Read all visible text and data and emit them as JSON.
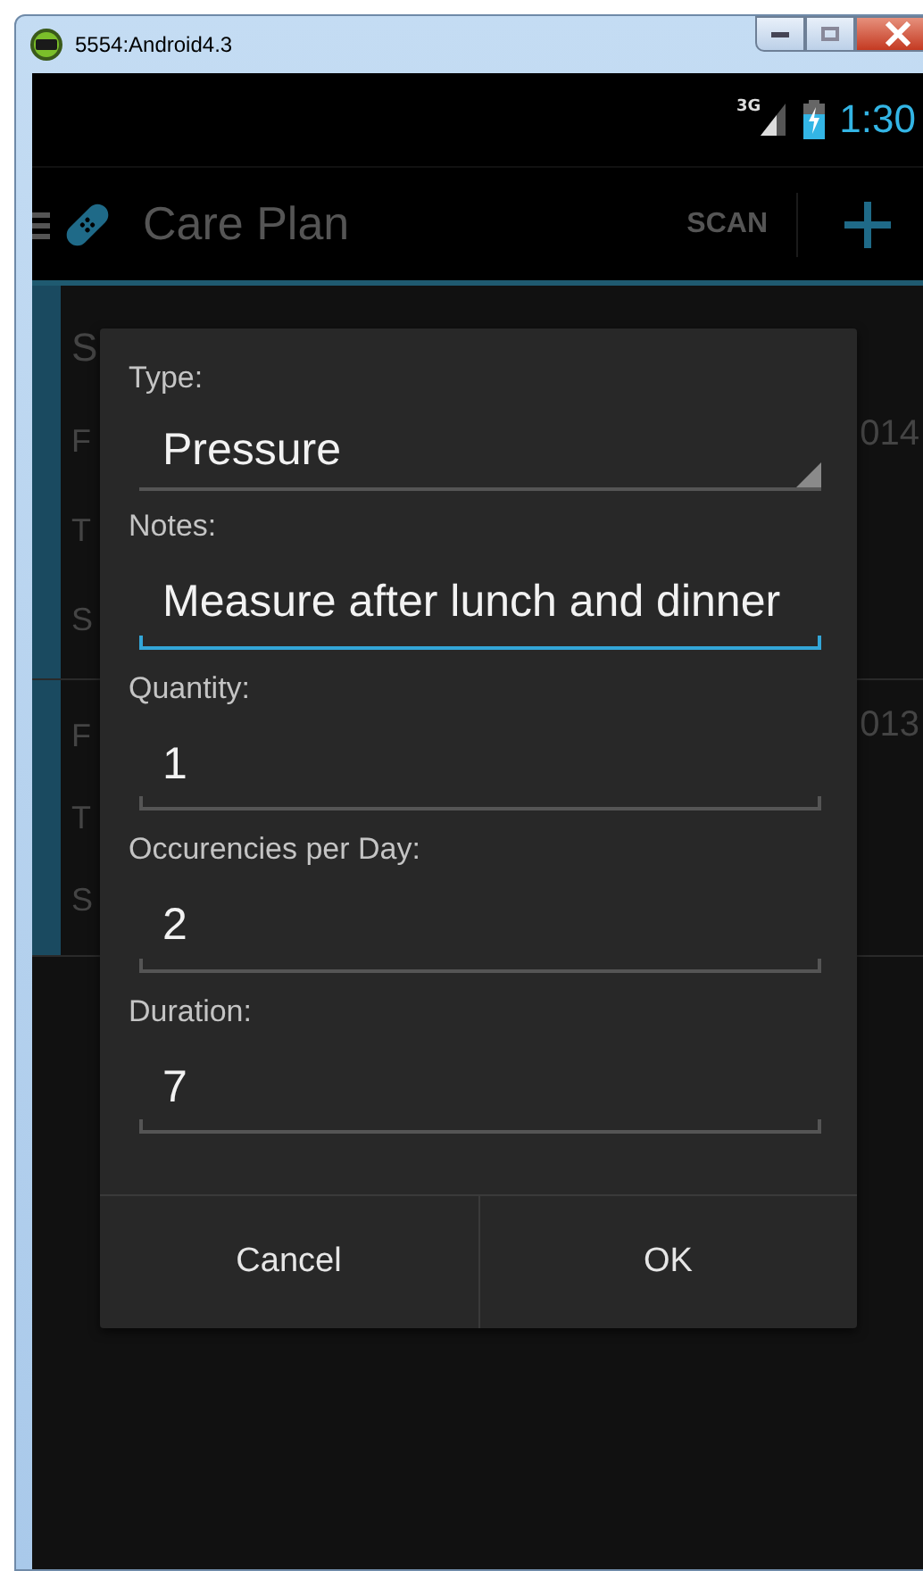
{
  "window": {
    "title": "5554:Android4.3"
  },
  "status_bar": {
    "network": "3G",
    "time": "1:30"
  },
  "action_bar": {
    "title": "Care Plan",
    "actions": [
      "SCAN"
    ]
  },
  "list_rows": [
    {
      "selected": true,
      "lines": [
        "S",
        "F",
        "T",
        "S"
      ],
      "side": "014"
    },
    {
      "selected": true,
      "lines": [
        "F",
        "T",
        "S"
      ],
      "side": "013"
    }
  ],
  "dialog": {
    "fields": [
      {
        "kind": "spinner",
        "label": "Type:",
        "value": "Pressure"
      },
      {
        "kind": "text",
        "label": "Notes:",
        "value": "Measure after lunch and dinner",
        "focused": true
      },
      {
        "kind": "text",
        "label": "Quantity:",
        "value": "1",
        "focused": false
      },
      {
        "kind": "text",
        "label": "Occurencies per Day:",
        "value": "2",
        "focused": false
      },
      {
        "kind": "text",
        "label": "Duration:",
        "value": "7",
        "focused": false
      }
    ],
    "buttons": [
      "Cancel",
      "OK"
    ]
  }
}
